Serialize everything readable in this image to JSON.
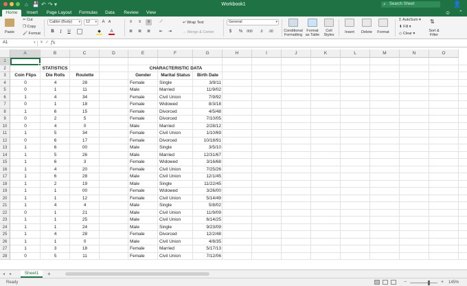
{
  "window": {
    "title": "Workbook1",
    "search_placeholder": "Search Sheet",
    "quick_access": [
      "⌂",
      "💾",
      "↶",
      "↷",
      "▾"
    ]
  },
  "ribbon_tabs": [
    "Home",
    "Insert",
    "Page Layout",
    "Formulas",
    "Data",
    "Review",
    "View"
  ],
  "active_tab": "Home",
  "ribbon": {
    "paste": "Paste",
    "cut": "Cut",
    "copy": "Copy",
    "format_painter": "Format",
    "font_name": "Calibri (Body)",
    "font_size": "12",
    "wrap_text": "Wrap Text",
    "merge_center": "Merge & Center",
    "number_format": "General",
    "conditional_formatting": "Conditional Formatting",
    "format_as_table": "Format as Table",
    "cell_styles": "Cell Styles",
    "insert": "Insert",
    "delete": "Delete",
    "format": "Format",
    "autosum": "AutoSum",
    "fill": "Fill",
    "clear": "Clear",
    "sort_filter": "Sort & Filter"
  },
  "formula_bar": {
    "name_box": "A1",
    "fx": "fx",
    "content": ""
  },
  "columns": [
    "A",
    "B",
    "C",
    "D",
    "E",
    "F",
    "G",
    "H",
    "I",
    "J",
    "K",
    "L",
    "M",
    "N",
    "O"
  ],
  "selected_cell": "A1",
  "sheet": {
    "statistics_title": "STATISTICS",
    "characteristic_title": "CHARACTERISTIC DATA",
    "headers": [
      "Coin Flips",
      "Die Rolls",
      "Roulette",
      "Gender",
      "Marital Status",
      "Birth Date"
    ],
    "rows": [
      [
        "0",
        "4",
        "28",
        "Female",
        "Single",
        "3/9/11"
      ],
      [
        "0",
        "1",
        "11",
        "Male",
        "Married",
        "11/9/02"
      ],
      [
        "1",
        "4",
        "34",
        "Female",
        "Civil Union",
        "7/9/92"
      ],
      [
        "0",
        "1",
        "18",
        "Female",
        "Widowed",
        "8/3/18"
      ],
      [
        "1",
        "6",
        "15",
        "Female",
        "Divorced",
        "4/5/48"
      ],
      [
        "0",
        "2",
        "5",
        "Female",
        "Divorced",
        "7/10/05"
      ],
      [
        "0",
        "4",
        "0",
        "Male",
        "Married",
        "2/28/12"
      ],
      [
        "1",
        "5",
        "34",
        "Female",
        "Civil Union",
        "1/10/69"
      ],
      [
        "0",
        "6",
        "17",
        "Female",
        "Divorced",
        "10/18/91"
      ],
      [
        "1",
        "6",
        "00",
        "Male",
        "Single",
        "3/5/10"
      ],
      [
        "1",
        "5",
        "26",
        "Male",
        "Married",
        "12/31/67"
      ],
      [
        "1",
        "6",
        "3",
        "Female",
        "Widowed",
        "3/16/68"
      ],
      [
        "1",
        "4",
        "20",
        "Female",
        "Civil Union",
        "7/25/26"
      ],
      [
        "1",
        "6",
        "28",
        "Male",
        "Civil Union",
        "12/1/45"
      ],
      [
        "1",
        "2",
        "19",
        "Male",
        "Single",
        "11/22/45"
      ],
      [
        "1",
        "1",
        "00",
        "Female",
        "Widowed",
        "3/26/00"
      ],
      [
        "1",
        "1",
        "12",
        "Female",
        "Civil Union",
        "5/14/49"
      ],
      [
        "1",
        "4",
        "4",
        "Male",
        "Single",
        "5/8/02"
      ],
      [
        "0",
        "1",
        "21",
        "Male",
        "Civil Union",
        "11/9/09"
      ],
      [
        "1",
        "1",
        "25",
        "Male",
        "Civil Union",
        "6/14/25"
      ],
      [
        "1",
        "1",
        "24",
        "Male",
        "Single",
        "9/23/09"
      ],
      [
        "1",
        "4",
        "28",
        "Female",
        "Divorced",
        "12/2/48"
      ],
      [
        "1",
        "1",
        "0",
        "Male",
        "Civil Union",
        "4/8/35"
      ],
      [
        "1",
        "3",
        "18",
        "Female",
        "Married",
        "5/17/13"
      ],
      [
        "0",
        "5",
        "11",
        "Female",
        "Civil Union",
        "7/12/06"
      ]
    ]
  },
  "sheet_tabs": [
    "Sheet1"
  ],
  "status": {
    "ready": "Ready",
    "zoom": "145%"
  },
  "colors": {
    "excel_green": "#1f7244",
    "ribbon_bg": "#f4f4f4",
    "header_bg": "#f0f0f0",
    "gridline": "#e2e2e2"
  }
}
